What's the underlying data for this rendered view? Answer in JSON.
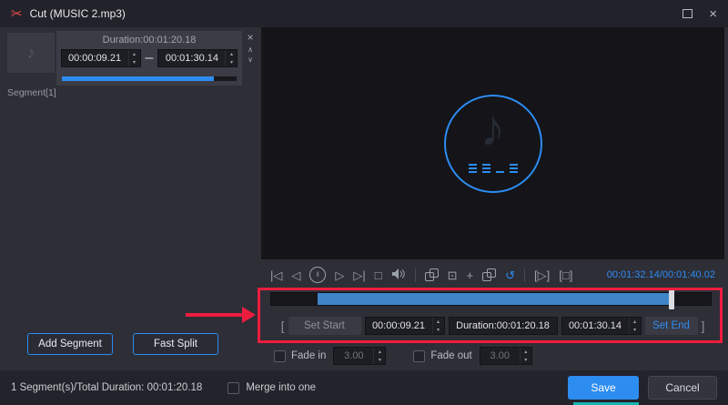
{
  "titlebar": {
    "app_icon": "✂",
    "title": "Cut (MUSIC 2.mp3)",
    "close_icon": "×"
  },
  "icons": {
    "spin_up": "▴",
    "spin_down": "▾",
    "chevron_up": "∧",
    "chevron_down": "∨",
    "remove": "×"
  },
  "left_panel": {
    "thumb_note_icon": "♪",
    "duration_label": "Duration:00:01:20.18",
    "start_time": "00:00:09.21",
    "range_separator": "–",
    "end_time": "00:01:30.14",
    "segment_label": "Segment[1]",
    "add_segment_button": "Add Segment",
    "fast_split_button": "Fast Split"
  },
  "preview": {
    "note_icon": "♪"
  },
  "controls": {
    "skip_back_icon": "|◁",
    "step_back_icon": "◁",
    "pause_icon": "‖",
    "step_forward_icon": "▷",
    "skip_forward_icon": "▷|",
    "stop_icon": "□",
    "snapshot_icon": "⊡",
    "add_icon": "+",
    "reset_icon": "↺",
    "play_segment_icon": "[▷]",
    "stop_segment_icon": "[□]",
    "time_display": "00:01:32.14/00:01:40.02"
  },
  "trim": {
    "left_bracket": "[",
    "set_start_button": "Set Start",
    "start_time": "00:00:09.21",
    "duration_label": "Duration:00:01:20.18",
    "end_time": "00:01:30.14",
    "set_end_button": "Set End",
    "right_bracket": "]"
  },
  "fade": {
    "fade_in_label": "Fade in",
    "fade_in_value": "3.00",
    "fade_out_label": "Fade out",
    "fade_out_value": "3.00"
  },
  "footer": {
    "summary": "1 Segment(s)/Total Duration: 00:01:20.18",
    "merge_label": "Merge into one",
    "save_button": "Save",
    "cancel_button": "Cancel"
  },
  "colors": {
    "accent": "#2d8cf0",
    "annotation": "#ee1d3e"
  }
}
